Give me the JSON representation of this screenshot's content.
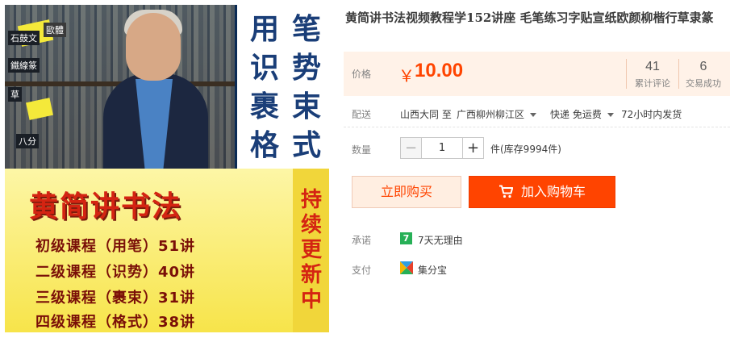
{
  "product_image": {
    "side_labels": [
      "石鼓文",
      "鐵線篆",
      "草",
      "八分",
      "歐體"
    ],
    "panel_chars": [
      "用",
      "笔",
      "识",
      "势",
      "裹",
      "束",
      "格",
      "式"
    ],
    "headline": "黄简讲书法",
    "vertical_text": [
      "持",
      "续",
      "更",
      "新",
      "中"
    ],
    "courses": [
      "初级课程（用笔）51讲",
      "二级课程（识势）40讲",
      "三级课程（裹束）31讲",
      "四级课程（格式）38讲"
    ]
  },
  "title": "黄简讲书法视频教程学152讲座 毛笔练习字贴宣纸欧颜柳楷行草隶篆",
  "price": {
    "label": "价格",
    "currency": "￥",
    "value": "10.00",
    "reviews_count": "41",
    "reviews_label": "累计评论",
    "sold_count": "6",
    "sold_label": "交易成功",
    "color": "#ff4400"
  },
  "shipping": {
    "label": "配送",
    "from": "山西大同 至",
    "to": "广西柳州柳江区",
    "method": "快递 免运费",
    "dispatch": "72小时内发货"
  },
  "quantity": {
    "label": "数量",
    "value": "1",
    "minus": "−",
    "plus": "+",
    "unit_stock": "件(库存9994件)"
  },
  "actions": {
    "buy_now": "立即购买",
    "add_to_cart": "加入购物车"
  },
  "promise": {
    "label": "承诺",
    "badge": "7",
    "text": "7天无理由"
  },
  "payment": {
    "label": "支付",
    "text": "集分宝"
  }
}
